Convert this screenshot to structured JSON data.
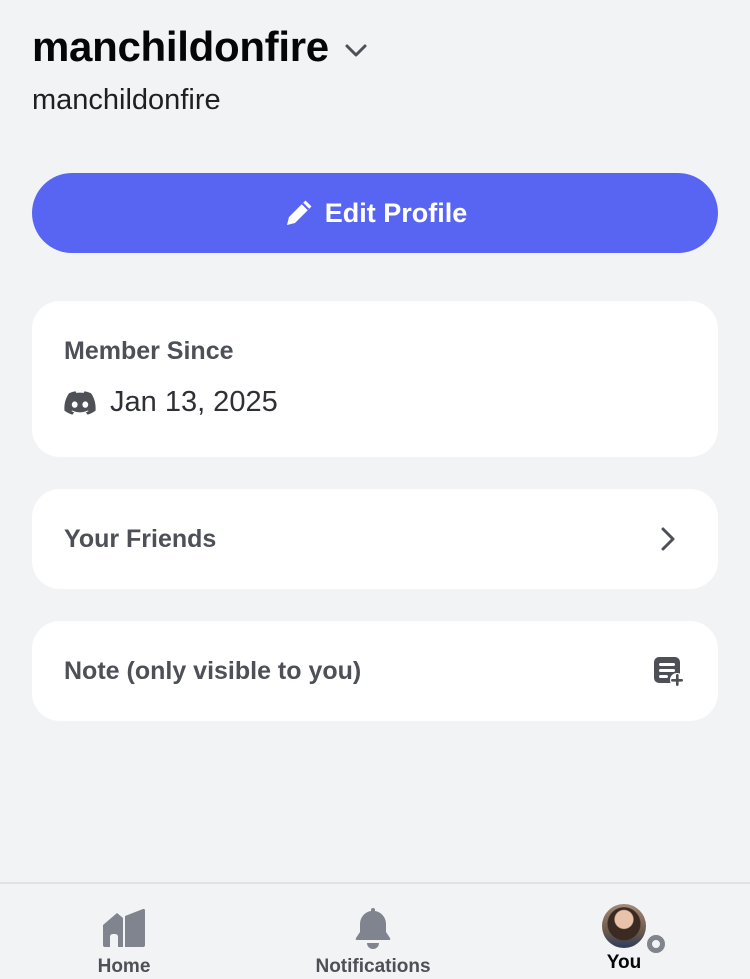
{
  "profile": {
    "display_name": "manchildonfire",
    "username": "manchildonfire"
  },
  "actions": {
    "edit_profile_label": "Edit Profile"
  },
  "member_since": {
    "title": "Member Since",
    "date": "Jan 13, 2025"
  },
  "friends": {
    "label": "Your Friends"
  },
  "note": {
    "label": "Note (only visible to you)"
  },
  "bottom_nav": {
    "items": [
      {
        "label": "Home",
        "icon": "home-icon"
      },
      {
        "label": "Notifications",
        "icon": "bell-icon"
      },
      {
        "label": "You",
        "icon": "avatar"
      }
    ]
  },
  "colors": {
    "accent": "#5865f2",
    "background": "#f2f3f5",
    "card": "#ffffff",
    "muted_text": "#4e5058",
    "status_idle": "#80848e"
  }
}
